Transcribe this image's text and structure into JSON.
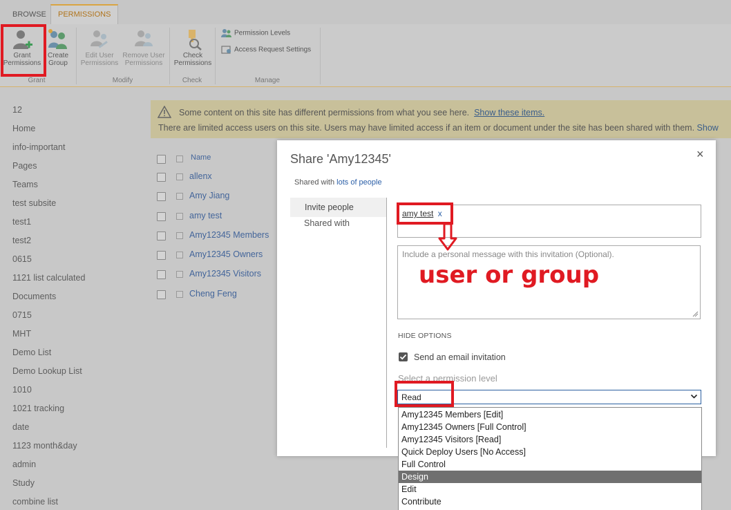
{
  "ribbon": {
    "tabs": [
      "BROWSE",
      "PERMISSIONS"
    ],
    "buttons": {
      "grant_permissions": "Grant Permissions",
      "create_group": "Create Group",
      "edit_user_permissions": "Edit User Permissions",
      "remove_user_permissions": "Remove User Permissions",
      "check_permissions": "Check Permissions"
    },
    "manage_items": [
      "Permission Levels",
      "Access Request Settings"
    ],
    "groups": [
      "Grant",
      "Modify",
      "Check",
      "Manage"
    ]
  },
  "nav": {
    "items": [
      "12",
      "Home",
      "info-important",
      "Pages",
      "Teams",
      "test subsite",
      "test1",
      "test2",
      "0615",
      "1121 list calculated",
      "Documents",
      "0715",
      "MHT",
      "Demo List",
      "Demo Lookup List",
      "1010",
      "1021 tracking",
      "date",
      "1123 month&day",
      "admin",
      "Study",
      "combine list"
    ]
  },
  "banner": {
    "line1": "Some content on this site has different permissions from what you see here.",
    "line1_link": "Show these items.",
    "line2": "There are limited access users on this site. Users may have limited access if an item or document under the site has been shared with them.",
    "line2_link": "Show"
  },
  "list": {
    "header": "Name",
    "rows": [
      "allenx",
      "Amy Jiang",
      "amy test",
      "Amy12345 Members",
      "Amy12345 Owners",
      "Amy12345 Visitors",
      "Cheng Feng"
    ]
  },
  "dialog": {
    "title": "Share 'Amy12345'",
    "close": "×",
    "shared_with_prefix": "Shared with",
    "shared_with_link": "lots of people",
    "tabs": [
      "Invite people",
      "Shared with"
    ],
    "chip_name": "amy test",
    "chip_remove": "x",
    "message_placeholder": "Include a personal message with this invitation (Optional).",
    "hide_options": "HIDE OPTIONS",
    "send_email_label": "Send an email invitation",
    "send_email_checked": true,
    "permission_label": "Select a permission level",
    "permission_value": "Read",
    "permission_options": [
      "Amy12345 Members [Edit]",
      "Amy12345 Owners [Full Control]",
      "Amy12345 Visitors [Read]",
      "Quick Deploy Users [No Access]",
      "Full Control",
      "Design",
      "Edit",
      "Contribute"
    ],
    "highlighted_option": "Design"
  },
  "annotation": {
    "text": "user or group",
    "color": "#e01a22"
  }
}
